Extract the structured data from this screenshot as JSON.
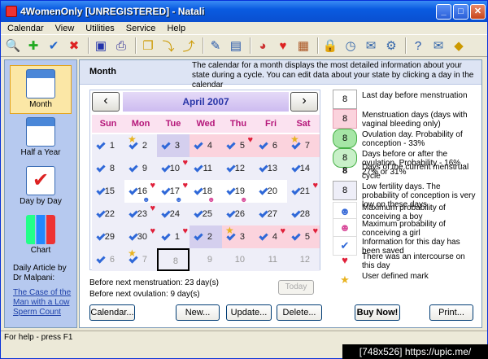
{
  "window": {
    "title": "4WomenOnly [UNREGISTERED] - Natali",
    "minimize": "_",
    "maximize": "□",
    "close": "✕"
  },
  "menu": [
    "Calendar",
    "View",
    "Utilities",
    "Service",
    "Help"
  ],
  "toolbar": {
    "icons": [
      "magnify-icon",
      "add-icon",
      "check-icon",
      "delete-icon",
      "save-icon",
      "print-preview-icon",
      "copy-icon",
      "export-icon",
      "import-icon",
      "edit-icon",
      "chart-icon",
      "pie-icon",
      "heart-icon",
      "grid-icon",
      "lock-icon",
      "clock-icon",
      "mail-icon",
      "gear-icon",
      "help-icon",
      "envelope-icon",
      "cube-icon"
    ]
  },
  "sidebar": {
    "items": [
      {
        "label": "Month",
        "icon": "calendar-month-icon"
      },
      {
        "label": "Half a Year",
        "icon": "calendar-half-year-icon"
      },
      {
        "label": "Day by Day",
        "icon": "day-by-day-icon"
      },
      {
        "label": "Chart",
        "icon": "bar-chart-icon"
      }
    ],
    "article_title": "Daily Article by Dr Malpani:",
    "article_link": "The Case of the Man with a Low Sperm Count"
  },
  "main": {
    "title": "Month",
    "description": "The calendar for a month displays the most detailed information about your state during a cycle. You can edit data about your state by clicking a day in the calendar"
  },
  "calendar": {
    "month": "April 2007",
    "prev": "‹",
    "next": "›",
    "days": [
      "Sun",
      "Mon",
      "Tue",
      "Wed",
      "Thu",
      "Fri",
      "Sat"
    ],
    "weeks": [
      [
        "1",
        "2",
        "3",
        "4",
        "5",
        "6",
        "7"
      ],
      [
        "8",
        "9",
        "10",
        "11",
        "12",
        "13",
        "14"
      ],
      [
        "15",
        "16",
        "17",
        "18",
        "19",
        "20",
        "21"
      ],
      [
        "22",
        "23",
        "24",
        "25",
        "26",
        "27",
        "28"
      ],
      [
        "29",
        "30",
        "1",
        "2",
        "3",
        "4",
        "5"
      ],
      [
        "6",
        "7",
        "8",
        "9",
        "10",
        "11",
        "12"
      ]
    ]
  },
  "info": {
    "before_menstruation": "Before next menstruation: 23 day(s)",
    "before_ovulation": "Before next ovulation: 9 day(s)",
    "today_label": "Today"
  },
  "legend": [
    {
      "box": "8",
      "text": "Last day before menstruation"
    },
    {
      "box": "8",
      "text": "Menstruation days (days with vaginal bleeding only)"
    },
    {
      "box": "8",
      "text": "Ovulation day. Probability of conception - 33%"
    },
    {
      "box": "8",
      "text": "Days before or after the ovulation. Probability - 16%, 27% or 31%"
    },
    {
      "box": "8",
      "text": "Days of the current menstrual cycle"
    },
    {
      "box": "8",
      "text": "Low fertility days. The probability of conception is very low on these days"
    },
    {
      "box": "",
      "text": "Maximum probability of conceiving a boy"
    },
    {
      "box": "",
      "text": "Maximum probability of conceiving a girl"
    },
    {
      "box": "",
      "text": "Information for this day has been saved"
    },
    {
      "box": "",
      "text": "There was an intercourse on this day"
    },
    {
      "box": "",
      "text": "User defined mark"
    }
  ],
  "buttons": {
    "calendar": "Calendar...",
    "new": "New...",
    "update": "Update...",
    "delete": "Delete...",
    "buynow": "Buy Now!",
    "print": "Print..."
  },
  "status": "For help - press F1",
  "watermark": "[748x526] https://upic.me/"
}
